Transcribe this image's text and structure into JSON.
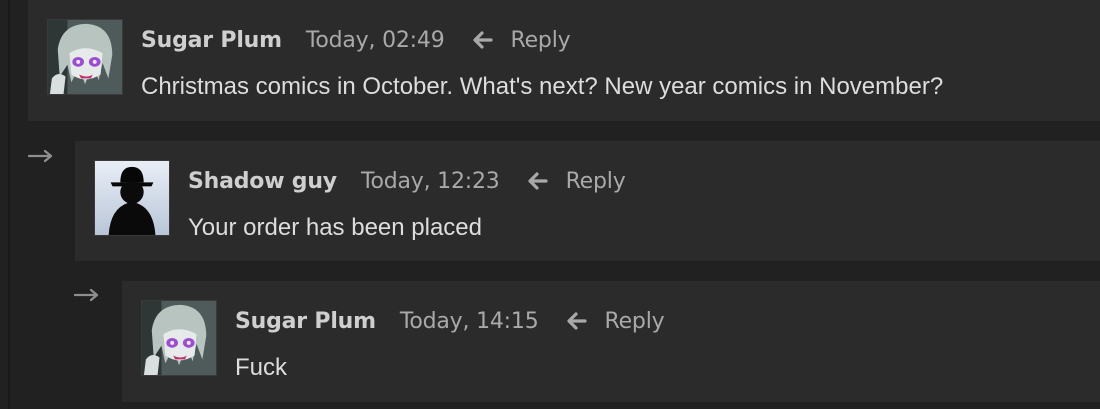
{
  "comments": [
    {
      "author": "Sugar Plum",
      "time": "Today, 02:49",
      "reply_label": "Reply",
      "text": "Christmas comics in October. What's next? New year comics in November?",
      "avatar_icon": "anime-girl-avatar"
    },
    {
      "author": "Shadow guy",
      "time": "Today, 12:23",
      "reply_label": "Reply",
      "text": "Your order has been placed",
      "avatar_icon": "shadow-figure-avatar"
    },
    {
      "author": "Sugar Plum",
      "time": "Today, 14:15",
      "reply_label": "Reply",
      "text": "Fuck",
      "avatar_icon": "anime-girl-avatar"
    }
  ],
  "colors": {
    "page_background": "#212121",
    "card_background": "#2b2b2b",
    "author_text": "#cfcfcf",
    "meta_text": "#a9a9a9",
    "body_text": "#dddddd"
  }
}
